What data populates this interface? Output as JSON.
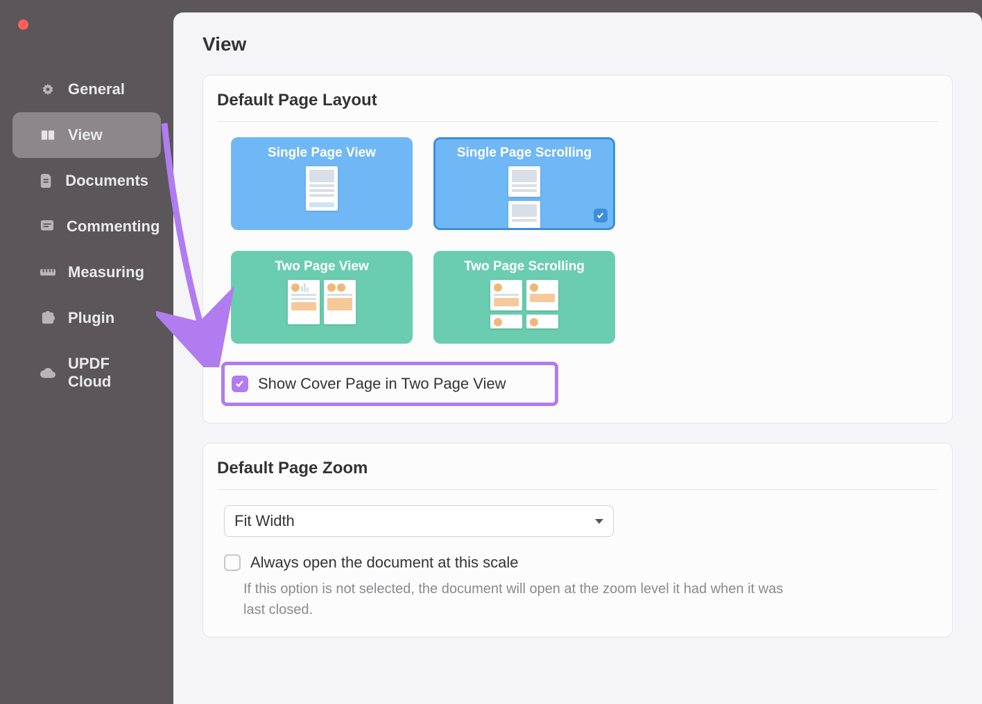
{
  "sidebar": {
    "items": [
      {
        "label": "General"
      },
      {
        "label": "View"
      },
      {
        "label": "Documents"
      },
      {
        "label": "Commenting"
      },
      {
        "label": "Measuring"
      },
      {
        "label": "Plugin"
      },
      {
        "label": "UPDF Cloud"
      }
    ],
    "activeIndex": 1
  },
  "page": {
    "title": "View"
  },
  "defaultLayout": {
    "heading": "Default Page Layout",
    "options": [
      {
        "label": "Single Page View"
      },
      {
        "label": "Single Page Scrolling"
      },
      {
        "label": "Two Page View"
      },
      {
        "label": "Two Page Scrolling"
      }
    ],
    "selectedIndex": 1,
    "coverCheckbox": {
      "checked": true,
      "label": "Show Cover Page in Two Page View"
    }
  },
  "defaultZoom": {
    "heading": "Default Page Zoom",
    "value": "Fit Width",
    "alwaysOpen": {
      "checked": false,
      "label": "Always open the document at this scale",
      "hint": "If this option is not selected, the document will open at the zoom level it had when it was last closed."
    }
  },
  "colors": {
    "highlight": "#b07cf0",
    "blue": "#70b7f6",
    "blueBorder": "#3d8edc",
    "teal": "#6acdb0"
  }
}
